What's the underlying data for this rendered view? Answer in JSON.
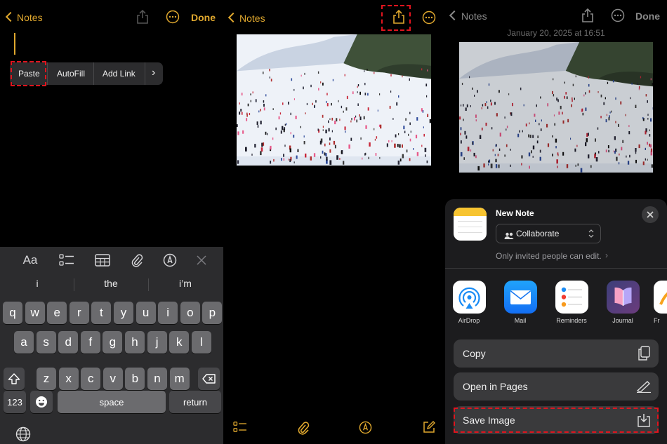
{
  "panel1": {
    "nav": {
      "back_label": "Notes",
      "done_label": "Done"
    },
    "edit_menu": {
      "paste": "Paste",
      "autofill": "AutoFill",
      "add_link": "Add Link",
      "more": "›"
    },
    "keyboard": {
      "toolbar_format": "Aa",
      "suggestions": [
        "i",
        "the",
        "i’m"
      ],
      "rows": [
        [
          "q",
          "w",
          "e",
          "r",
          "t",
          "y",
          "u",
          "i",
          "o",
          "p"
        ],
        [
          "a",
          "s",
          "d",
          "f",
          "g",
          "h",
          "j",
          "k",
          "l"
        ],
        [
          "z",
          "x",
          "c",
          "v",
          "b",
          "n",
          "m"
        ]
      ],
      "numbers_key": "123",
      "space_key": "space",
      "return_key": "return"
    }
  },
  "panel2": {
    "nav": {
      "back_label": "Notes"
    }
  },
  "panel3": {
    "nav": {
      "back_label": "Notes",
      "done_label": "Done"
    },
    "timestamp": "January 20, 2025 at 16:51",
    "share_sheet": {
      "note_title": "New Note",
      "collaborate_label": "Collaborate",
      "permission_text": "Only invited people can edit.",
      "apps": [
        {
          "name": "AirDrop"
        },
        {
          "name": "Mail"
        },
        {
          "name": "Reminders"
        },
        {
          "name": "Journal"
        },
        {
          "name": "Fr"
        }
      ],
      "actions": [
        {
          "label": "Copy"
        },
        {
          "label": "Open in Pages"
        },
        {
          "label": "Save Image"
        }
      ]
    }
  },
  "colors": {
    "accent": "#e0a82e",
    "highlight": "#e0141e",
    "sheet_bg": "#1c1c1e",
    "key_bg": "#6b6b6e"
  }
}
